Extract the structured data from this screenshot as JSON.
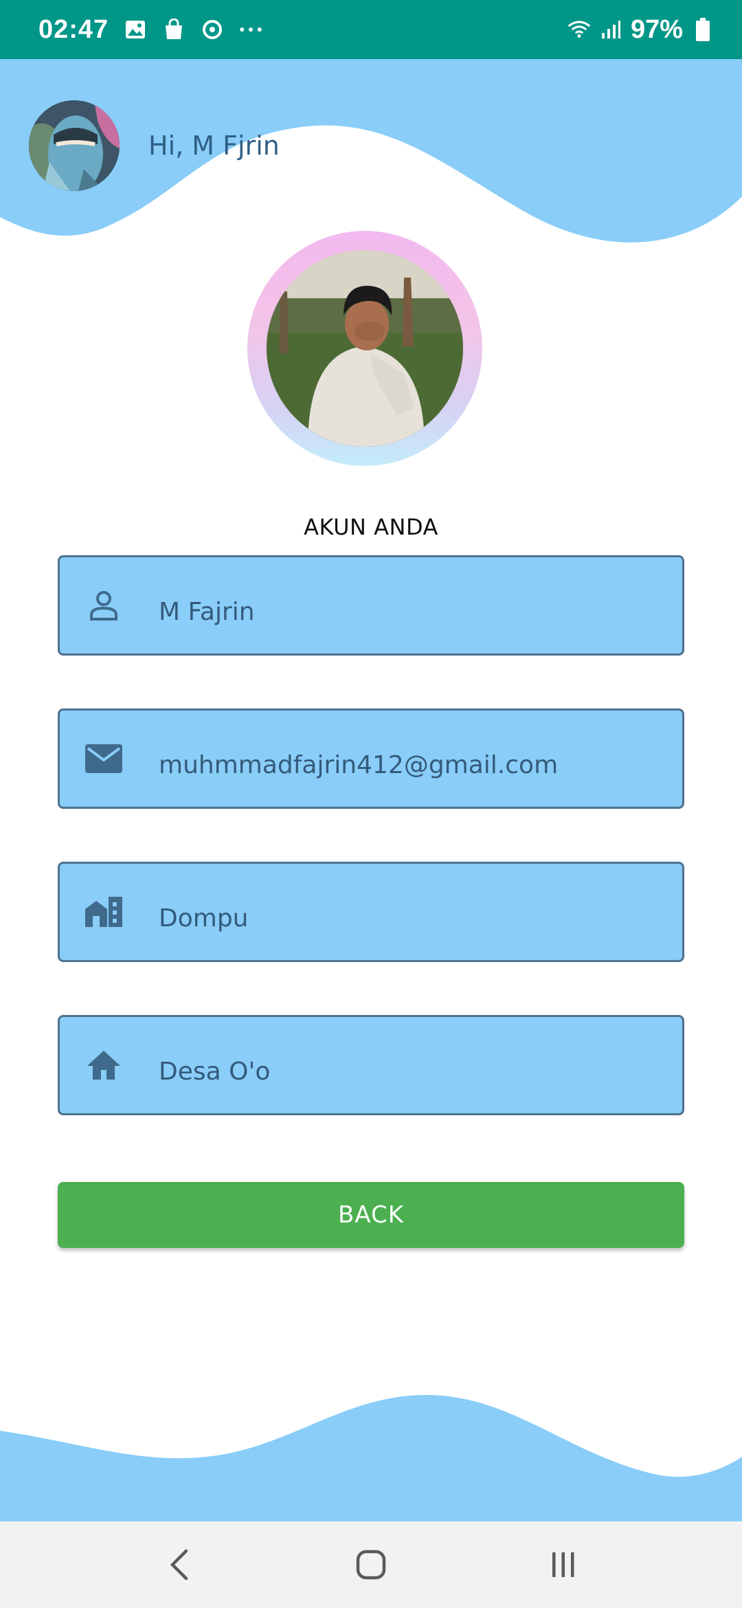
{
  "status_bar": {
    "time": "02:47",
    "battery": "97%",
    "left_icons": [
      "gallery-icon",
      "shopping-bag-icon",
      "sync-icon",
      "more-dots-icon"
    ],
    "right_icons": [
      "wifi-icon",
      "signal-icon",
      "battery-icon"
    ]
  },
  "header": {
    "greeting": "Hi, M Fjrin"
  },
  "section_title": "AKUN ANDA",
  "fields": {
    "name": {
      "icon": "person-icon",
      "value": "M Fajrin"
    },
    "email": {
      "icon": "mail-icon",
      "value": "muhmmadfajrin412@gmail.com"
    },
    "city": {
      "icon": "city-icon",
      "value": "Dompu"
    },
    "village": {
      "icon": "home-icon",
      "value": "Desa O'o"
    }
  },
  "back_button": {
    "label": "BACK"
  },
  "nav_bar": [
    "back-icon",
    "home-circle-icon",
    "recents-icon"
  ],
  "colors": {
    "status_bar": "#009688",
    "wave": "#89cdf8",
    "field_bg": "#89cdf8",
    "field_border": "#4e7290",
    "field_text": "#345a7a",
    "button": "#4caf50"
  }
}
